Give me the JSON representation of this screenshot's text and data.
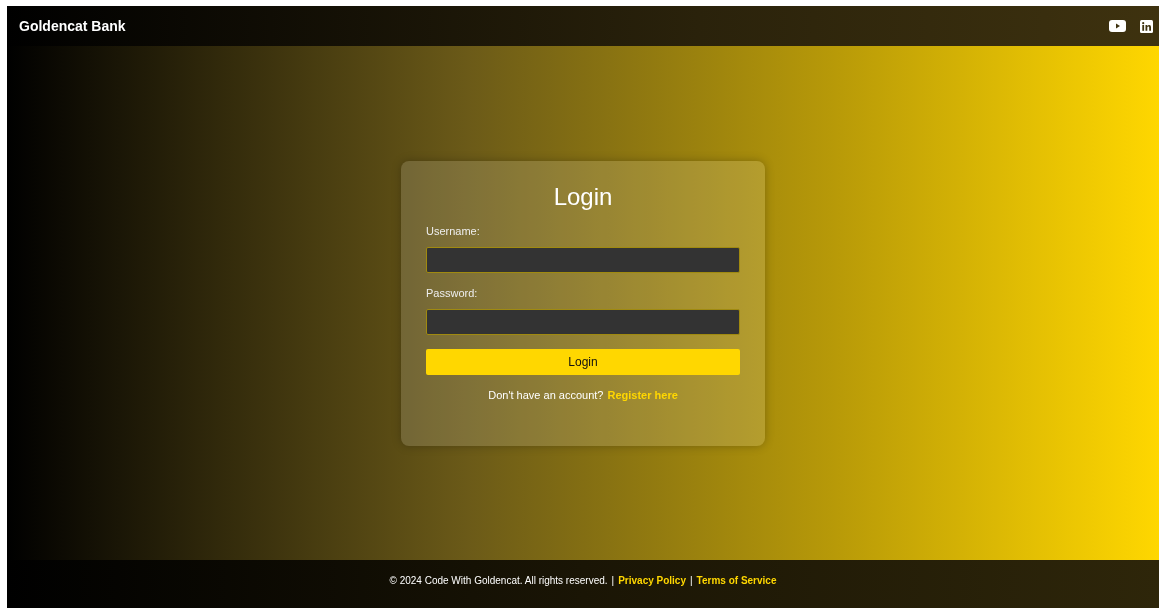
{
  "header": {
    "brand": "Goldencat Bank",
    "social": [
      {
        "kind": "youtube"
      },
      {
        "kind": "linkedin"
      }
    ]
  },
  "login": {
    "title": "Login",
    "fields": [
      {
        "label": "Username:"
      },
      {
        "label": "Password:"
      }
    ],
    "button": "Login",
    "prompt": "Don't have an account?",
    "link": "Register here"
  },
  "footer": {
    "items": [
      {
        "kind": "text",
        "text": "© 2024 Code With Goldencat. All rights reserved."
      },
      {
        "kind": "separator",
        "text": "|"
      },
      {
        "kind": "link",
        "text": "Privacy Policy"
      },
      {
        "kind": "separator",
        "text": "|"
      },
      {
        "kind": "link",
        "text": "Terms of Service"
      }
    ]
  }
}
